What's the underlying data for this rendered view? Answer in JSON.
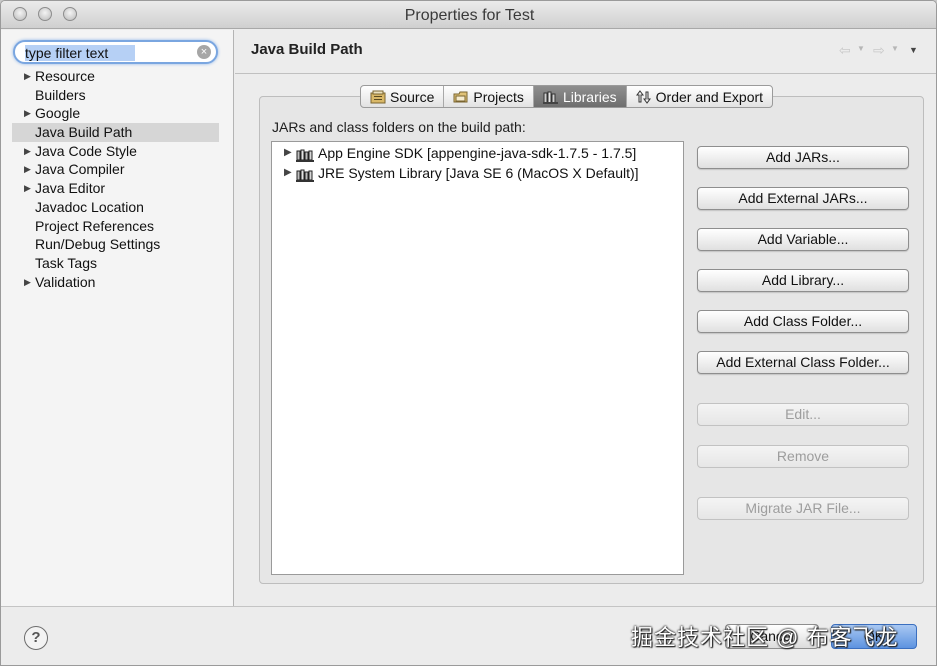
{
  "window": {
    "title": "Properties for Test"
  },
  "filter": {
    "value": "type filter text",
    "placeholder": "type filter text"
  },
  "sidebar": {
    "items": [
      {
        "label": "Resource",
        "expandable": true
      },
      {
        "label": "Builders",
        "expandable": false
      },
      {
        "label": "Google",
        "expandable": true
      },
      {
        "label": "Java Build Path",
        "expandable": false,
        "selected": true
      },
      {
        "label": "Java Code Style",
        "expandable": true
      },
      {
        "label": "Java Compiler",
        "expandable": true
      },
      {
        "label": "Java Editor",
        "expandable": true
      },
      {
        "label": "Javadoc Location",
        "expandable": false
      },
      {
        "label": "Project References",
        "expandable": false
      },
      {
        "label": "Run/Debug Settings",
        "expandable": false
      },
      {
        "label": "Task Tags",
        "expandable": false
      },
      {
        "label": "Validation",
        "expandable": true
      }
    ]
  },
  "page": {
    "title": "Java Build Path"
  },
  "tabs": [
    {
      "label": "Source",
      "icon": "source-folder-icon"
    },
    {
      "label": "Projects",
      "icon": "projects-folder-icon"
    },
    {
      "label": "Libraries",
      "icon": "library-icon",
      "active": true
    },
    {
      "label": "Order and Export",
      "icon": "order-export-icon"
    }
  ],
  "libraries": {
    "label": "JARs and class folders on the build path:",
    "items": [
      {
        "label": "App Engine SDK [appengine-java-sdk-1.7.5 - 1.7.5]",
        "icon": "library-icon"
      },
      {
        "label": "JRE System Library [Java SE 6 (MacOS X Default)]",
        "icon": "library-icon"
      }
    ]
  },
  "buttons": {
    "add_jars": "Add JARs...",
    "add_external_jars": "Add External JARs...",
    "add_variable": "Add Variable...",
    "add_library": "Add Library...",
    "add_class_folder": "Add Class Folder...",
    "add_external_class_folder": "Add External Class Folder...",
    "edit": "Edit...",
    "remove": "Remove",
    "migrate_jar": "Migrate JAR File..."
  },
  "footer": {
    "cancel": "Cancel",
    "ok": "OK",
    "watermark": "掘金技术社区 @ 布客飞龙"
  },
  "colors": {
    "accent_blue": "#5d93e0",
    "selection_gray": "#d6d6d6",
    "active_tab": "#7a7a7a"
  }
}
